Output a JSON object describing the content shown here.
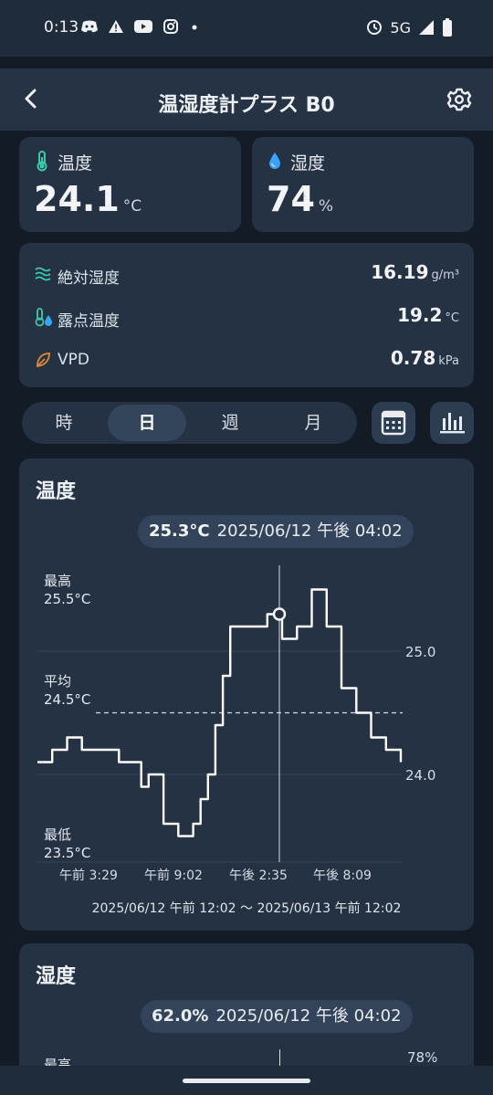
{
  "status": {
    "time": "0:13",
    "network": "5G",
    "left_icons": [
      "discord-icon",
      "warning-icon",
      "youtube-icon",
      "instagram-icon",
      "dot-icon"
    ],
    "right_icons": [
      "alarm-icon",
      "signal-icon",
      "battery-icon"
    ]
  },
  "header": {
    "title": "温湿度計プラス B0"
  },
  "temperature": {
    "label": "温度",
    "value": "24.1",
    "unit": "°C"
  },
  "humidity": {
    "label": "湿度",
    "value": "74",
    "unit": "%"
  },
  "metrics": [
    {
      "label": "絶対湿度",
      "value": "16.19",
      "unit": "g/m³",
      "icon": "absolute-humidity-icon"
    },
    {
      "label": "露点温度",
      "value": "19.2",
      "unit": "°C",
      "icon": "dew-point-icon"
    },
    {
      "label": "VPD",
      "value": "0.78",
      "unit": "kPa",
      "icon": "leaf-icon"
    }
  ],
  "period_tabs": [
    {
      "label": "時",
      "active": false
    },
    {
      "label": "日",
      "active": true
    },
    {
      "label": "週",
      "active": false
    },
    {
      "label": "月",
      "active": false
    }
  ],
  "chart1": {
    "title": "温度",
    "tooltip_value": "25.3°C",
    "tooltip_time": "2025/06/12 午後 04:02",
    "max_label": "最高",
    "max_value": "25.5°C",
    "avg_label": "平均",
    "avg_value": "24.5°C",
    "min_label": "最低",
    "min_value": "23.5°C",
    "range": "2025/06/12 午前 12:02 〜 2025/06/13 午前 12:02"
  },
  "chart2": {
    "title": "湿度",
    "tooltip_value": "62.0%",
    "tooltip_time": "2025/06/12 午後 04:02",
    "max_label": "最高",
    "y_tick": "78%"
  },
  "colors": {
    "accent_line": "#ffffff",
    "thermo": "#3cc9a8",
    "drop": "#3ba3f5",
    "leaf": "#e08a3a"
  },
  "chart_data": {
    "type": "line",
    "title": "温度",
    "x_ticks": [
      "午前 3:29",
      "午前 9:02",
      "午後 2:35",
      "午後 8:09"
    ],
    "y_ticks": [
      24.0,
      25.0
    ],
    "ylim": [
      23.5,
      25.5
    ],
    "avg_line": 24.5,
    "grid": true,
    "series": [
      {
        "values": [
          24.1,
          24.1,
          24.2,
          24.2,
          24.3,
          24.3,
          24.2,
          24.2,
          24.2,
          24.2,
          24.2,
          24.1,
          24.1,
          24.1,
          23.9,
          24.0,
          24.0,
          23.6,
          23.6,
          23.5,
          23.5,
          23.6,
          23.8,
          24.0,
          24.4,
          24.8,
          25.2,
          25.2,
          25.2,
          25.2,
          25.2,
          25.3,
          25.3,
          25.1,
          25.1,
          25.2,
          25.2,
          25.5,
          25.5,
          25.2,
          25.2,
          24.7,
          24.7,
          24.5,
          24.5,
          24.3,
          24.3,
          24.2,
          24.2,
          24.1
        ]
      }
    ],
    "highlight": {
      "x": "午後 4:02",
      "y": 25.3
    }
  }
}
